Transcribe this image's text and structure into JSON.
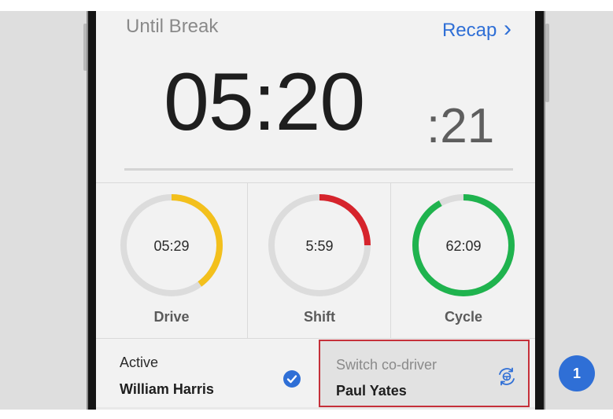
{
  "header": {
    "title": "Until Break",
    "recap_label": "Recap",
    "recap_chevron": "›"
  },
  "timer": {
    "main": "05:20",
    "seconds": ":21"
  },
  "gauges": [
    {
      "label": "Drive",
      "value": "05:29",
      "progress": 0.4,
      "color": "#f3c01c"
    },
    {
      "label": "Shift",
      "value": "5:59",
      "progress": 0.25,
      "color": "#d6242c"
    },
    {
      "label": "Cycle",
      "value": "62:09",
      "progress": 0.92,
      "color": "#1fb34e"
    }
  ],
  "drivers": {
    "active_label": "Active",
    "active_name": "William Harris",
    "switch_label": "Switch co-driver",
    "codriver_name": "Paul Yates"
  },
  "callout": {
    "number": "1"
  },
  "icons": {
    "check": "check-circle-icon",
    "switch": "switch-driver-icon",
    "chevron": "chevron-right-icon"
  },
  "colors": {
    "accent": "#2f6fd6",
    "highlight": "#c5303a",
    "track": "#dcdcdc"
  }
}
